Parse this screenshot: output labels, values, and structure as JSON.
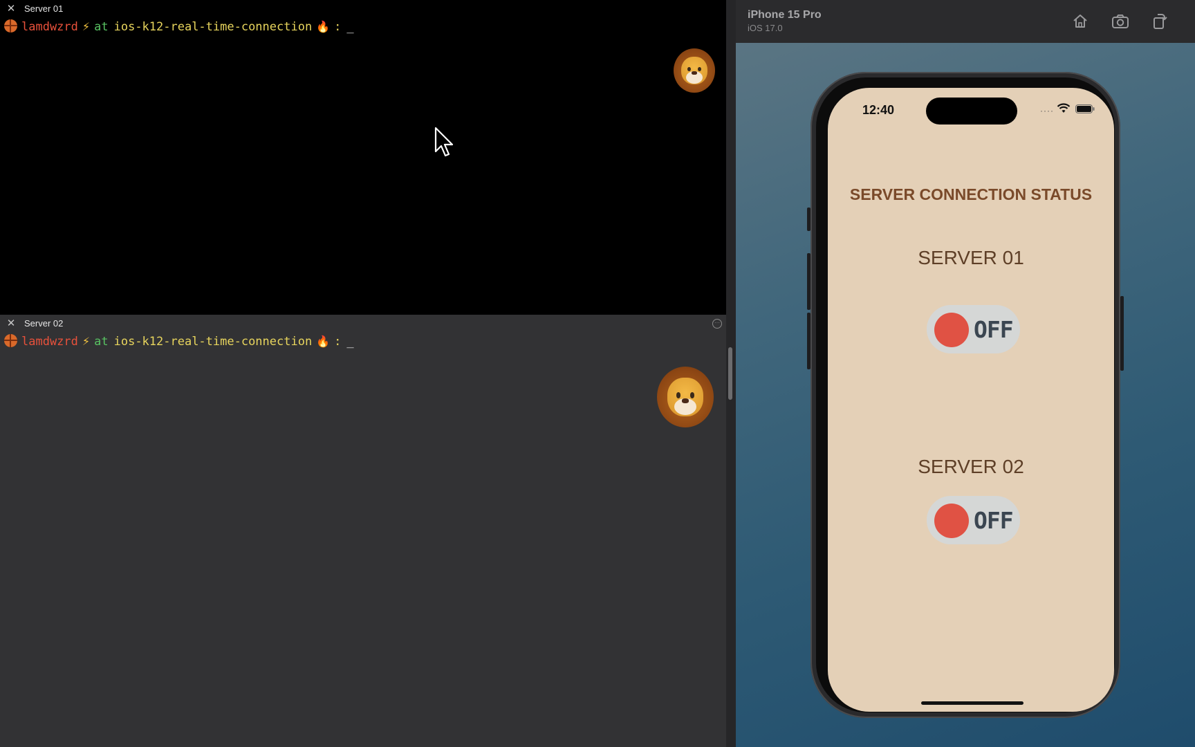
{
  "terminal": {
    "panes": [
      {
        "title": "Server 01",
        "prompt": {
          "user": "lamdwzrd",
          "bolt": "⚡",
          "at": "at",
          "repo": "ios-k12-real-time-connection",
          "fire": "🔥",
          "colon": ":",
          "cursor": "_"
        }
      },
      {
        "title": "Server 02",
        "prompt": {
          "user": "lamdwzrd",
          "bolt": "⚡",
          "at": "at",
          "repo": "ios-k12-real-time-connection",
          "fire": "🔥",
          "colon": ":",
          "cursor": "_"
        }
      }
    ],
    "colors": {
      "top_background": "#000000",
      "bottom_background": "#323234",
      "user": "#e8513b",
      "at": "#58c262",
      "repo": "#e8d55d"
    }
  },
  "simulator": {
    "device_name": "iPhone 15 Pro",
    "os_version": "iOS 17.0",
    "toolbar_icons": [
      "home-icon",
      "screenshot-icon",
      "rotate-icon"
    ],
    "status_time": "12:40",
    "app": {
      "title": "SERVER CONNECTION STATUS",
      "servers": [
        {
          "label": "SERVER 01",
          "state": "OFF"
        },
        {
          "label": "SERVER 02",
          "state": "OFF"
        }
      ],
      "colors": {
        "background": "#e4d0b7",
        "title": "#7a4a2a",
        "toggle_off_knob": "#e05244",
        "toggle_track": "#d5d7d6"
      }
    }
  }
}
